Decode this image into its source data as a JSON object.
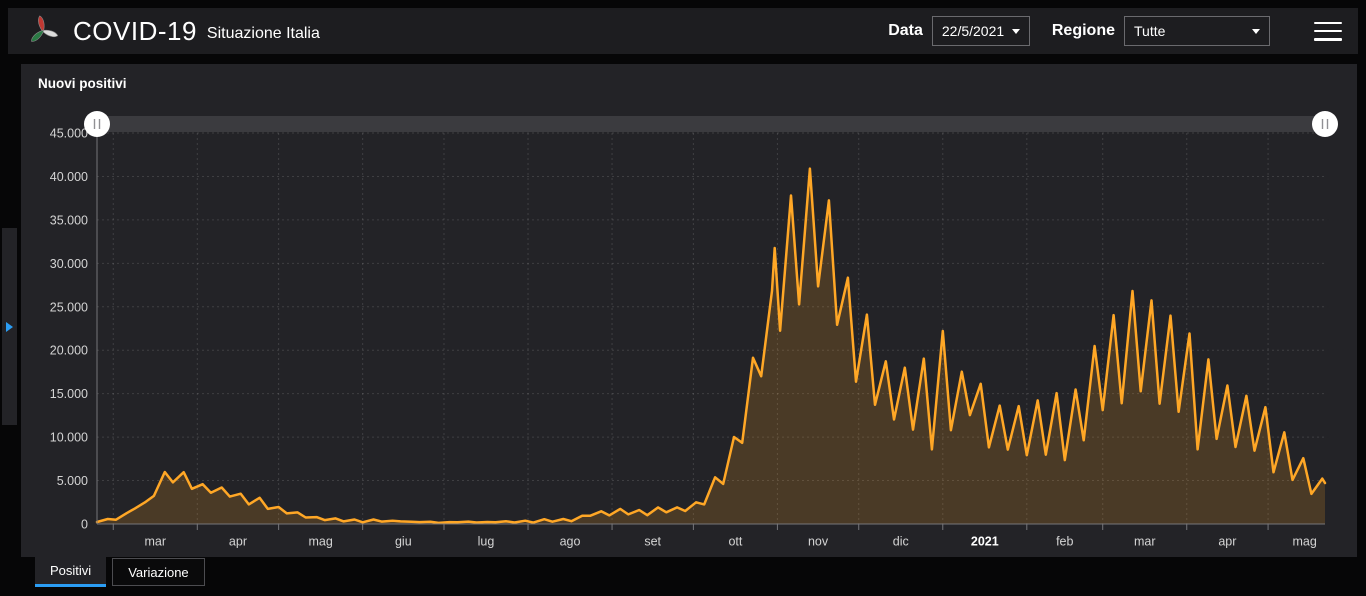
{
  "header": {
    "title": "COVID-19",
    "subtitle": "Situazione Italia",
    "data_label": "Data",
    "data_value": "22/5/2021",
    "regione_label": "Regione",
    "regione_value": "Tutte"
  },
  "tabs": [
    {
      "label": "Positivi",
      "active": true
    },
    {
      "label": "Variazione",
      "active": false
    }
  ],
  "chart_data": {
    "type": "area",
    "title": "Nuovi positivi",
    "legend": "none",
    "grid": "dashed",
    "y_axis": {
      "min": 0,
      "max": 45000,
      "step": 5000,
      "tick_labels": [
        "0",
        "5.000",
        "10.000",
        "15.000",
        "20.000",
        "25.000",
        "30.000",
        "35.000",
        "40.000",
        "45.000"
      ]
    },
    "x_axis": {
      "unit": "day offset from 24/2/2020",
      "end_day": 453,
      "months": [
        {
          "label": "mar",
          "start": 6,
          "end": 37
        },
        {
          "label": "apr",
          "start": 37,
          "end": 67
        },
        {
          "label": "mag",
          "start": 67,
          "end": 98
        },
        {
          "label": "giu",
          "start": 98,
          "end": 128
        },
        {
          "label": "lug",
          "start": 128,
          "end": 159
        },
        {
          "label": "ago",
          "start": 159,
          "end": 190
        },
        {
          "label": "set",
          "start": 190,
          "end": 220
        },
        {
          "label": "ott",
          "start": 220,
          "end": 251
        },
        {
          "label": "nov",
          "start": 251,
          "end": 281
        },
        {
          "label": "dic",
          "start": 281,
          "end": 312
        },
        {
          "label": "2021",
          "start": 312,
          "end": 343,
          "bold": true
        },
        {
          "label": "feb",
          "start": 343,
          "end": 371
        },
        {
          "label": "mar",
          "start": 371,
          "end": 402
        },
        {
          "label": "apr",
          "start": 402,
          "end": 432
        },
        {
          "label": "mag",
          "start": 432,
          "end": 459
        }
      ]
    },
    "series": [
      {
        "name": "Nuovi positivi",
        "points": [
          [
            0,
            230
          ],
          [
            4,
            580
          ],
          [
            7,
            500
          ],
          [
            11,
            1250
          ],
          [
            14,
            1800
          ],
          [
            18,
            2550
          ],
          [
            21,
            3230
          ],
          [
            25,
            5990
          ],
          [
            28,
            4790
          ],
          [
            32,
            5960
          ],
          [
            35,
            4050
          ],
          [
            39,
            4580
          ],
          [
            42,
            3600
          ],
          [
            46,
            4200
          ],
          [
            49,
            3150
          ],
          [
            53,
            3490
          ],
          [
            56,
            2260
          ],
          [
            60,
            3020
          ],
          [
            63,
            1740
          ],
          [
            67,
            1960
          ],
          [
            70,
            1220
          ],
          [
            74,
            1330
          ],
          [
            77,
            750
          ],
          [
            81,
            790
          ],
          [
            84,
            450
          ],
          [
            88,
            650
          ],
          [
            91,
            300
          ],
          [
            95,
            520
          ],
          [
            98,
            200
          ],
          [
            102,
            520
          ],
          [
            105,
            280
          ],
          [
            109,
            380
          ],
          [
            112,
            300
          ],
          [
            116,
            250
          ],
          [
            119,
            220
          ],
          [
            123,
            255
          ],
          [
            126,
            125
          ],
          [
            130,
            220
          ],
          [
            133,
            210
          ],
          [
            137,
            275
          ],
          [
            140,
            170
          ],
          [
            144,
            235
          ],
          [
            147,
            190
          ],
          [
            151,
            305
          ],
          [
            154,
            170
          ],
          [
            158,
            380
          ],
          [
            161,
            160
          ],
          [
            165,
            550
          ],
          [
            168,
            260
          ],
          [
            172,
            575
          ],
          [
            175,
            320
          ],
          [
            179,
            945
          ],
          [
            182,
            955
          ],
          [
            186,
            1460
          ],
          [
            189,
            995
          ],
          [
            193,
            1735
          ],
          [
            196,
            1110
          ],
          [
            200,
            1615
          ],
          [
            203,
            1010
          ],
          [
            207,
            1905
          ],
          [
            210,
            1350
          ],
          [
            214,
            1910
          ],
          [
            217,
            1495
          ],
          [
            221,
            2500
          ],
          [
            224,
            2255
          ],
          [
            228,
            5370
          ],
          [
            231,
            4620
          ],
          [
            235,
            10010
          ],
          [
            238,
            9340
          ],
          [
            242,
            19140
          ],
          [
            245,
            17010
          ],
          [
            249,
            26830
          ],
          [
            250,
            31760
          ],
          [
            252,
            22250
          ],
          [
            256,
            37810
          ],
          [
            259,
            25270
          ],
          [
            263,
            40900
          ],
          [
            266,
            27350
          ],
          [
            270,
            37240
          ],
          [
            273,
            22930
          ],
          [
            277,
            28350
          ],
          [
            280,
            16380
          ],
          [
            284,
            24100
          ],
          [
            287,
            13720
          ],
          [
            291,
            18730
          ],
          [
            294,
            12030
          ],
          [
            298,
            17990
          ],
          [
            301,
            10870
          ],
          [
            305,
            19040
          ],
          [
            308,
            8580
          ],
          [
            312,
            22210
          ],
          [
            315,
            10800
          ],
          [
            319,
            17530
          ],
          [
            322,
            12530
          ],
          [
            326,
            16140
          ],
          [
            329,
            8820
          ],
          [
            333,
            13630
          ],
          [
            336,
            8560
          ],
          [
            340,
            13570
          ],
          [
            343,
            7920
          ],
          [
            347,
            14220
          ],
          [
            350,
            7970
          ],
          [
            354,
            15060
          ],
          [
            357,
            7350
          ],
          [
            361,
            15480
          ],
          [
            364,
            9630
          ],
          [
            368,
            20490
          ],
          [
            371,
            13110
          ],
          [
            375,
            24040
          ],
          [
            378,
            13900
          ],
          [
            382,
            26820
          ],
          [
            385,
            15270
          ],
          [
            389,
            25730
          ],
          [
            392,
            13840
          ],
          [
            396,
            23980
          ],
          [
            399,
            12910
          ],
          [
            403,
            21930
          ],
          [
            406,
            8590
          ],
          [
            410,
            18940
          ],
          [
            413,
            9790
          ],
          [
            417,
            15940
          ],
          [
            420,
            8860
          ],
          [
            424,
            14760
          ],
          [
            427,
            8440
          ],
          [
            431,
            13440
          ],
          [
            434,
            5950
          ],
          [
            438,
            10550
          ],
          [
            441,
            5080
          ],
          [
            445,
            7570
          ],
          [
            448,
            3460
          ],
          [
            452,
            5220
          ],
          [
            453,
            4720
          ]
        ]
      }
    ],
    "colors": {
      "line": "#FFA726",
      "fill": "rgba(255,167,38,0.18)",
      "grid": "rgba(255,255,255,0.13)",
      "axis": "#76767a",
      "tick_text": "#d4d4d4",
      "track": "#3b3b3f",
      "handle": "#ffffff",
      "grip": "#909094",
      "accent_blue": "#2b9df4"
    }
  }
}
